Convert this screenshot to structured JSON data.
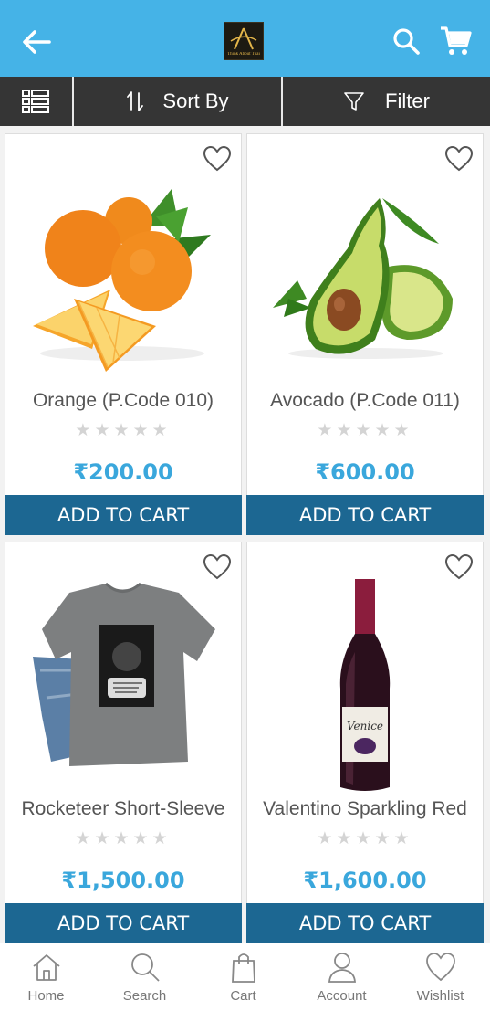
{
  "header": {
    "logo_text": "Think About Thai",
    "back_icon": "arrow-left-icon",
    "search_icon": "search-icon",
    "cart_icon": "cart-icon",
    "bar_color": "#45b3e7"
  },
  "toolbar": {
    "sort_label": "Sort By",
    "filter_label": "Filter",
    "bg_color": "#353535"
  },
  "products": [
    {
      "name": "Orange (P.Code 010)",
      "price": "₹200.00",
      "rating": 0,
      "stars": "★★★★★",
      "add_label": "ADD TO CART",
      "image_icon": "orange-fruit-image"
    },
    {
      "name": "Avocado (P.Code 011)",
      "price": "₹600.00",
      "rating": 0,
      "stars": "★★★★★",
      "add_label": "ADD TO CART",
      "image_icon": "avocado-image"
    },
    {
      "name": "Rocketeer Short-Sleeve",
      "price": "₹1,500.00",
      "rating": 0,
      "stars": "★★★★★",
      "add_label": "ADD TO CART",
      "image_icon": "tshirt-jeans-image"
    },
    {
      "name": "Valentino Sparkling Red",
      "price": "₹1,600.00",
      "rating": 0,
      "stars": "★★★★★",
      "add_label": "ADD TO CART",
      "image_icon": "wine-bottle-image"
    }
  ],
  "bottom_nav": [
    {
      "label": "Home",
      "icon": "home-icon"
    },
    {
      "label": "Search",
      "icon": "search-icon"
    },
    {
      "label": "Cart",
      "icon": "shopping-bag-icon"
    },
    {
      "label": "Account",
      "icon": "user-icon"
    },
    {
      "label": "Wishlist",
      "icon": "heart-icon"
    }
  ],
  "colors": {
    "accent": "#45b3e7",
    "add_to_cart": "#1c6792",
    "price": "#3aa7dc"
  }
}
